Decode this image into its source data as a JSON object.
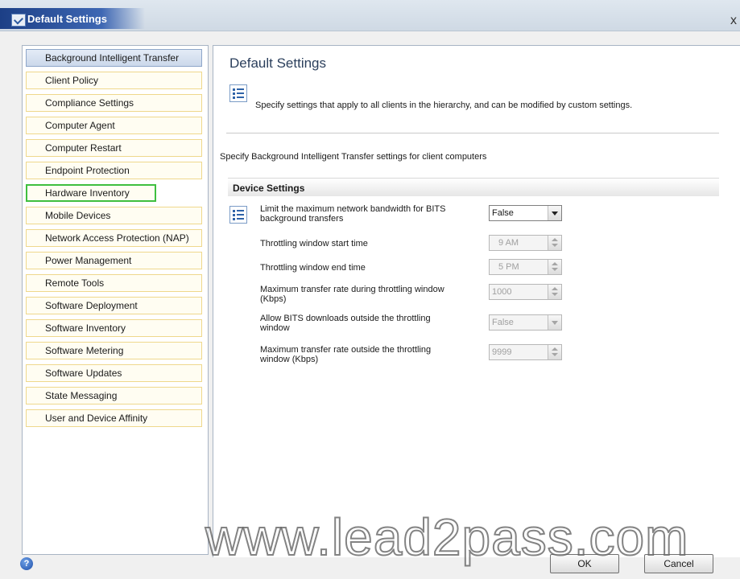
{
  "window": {
    "title": "Default Settings",
    "close_glyph": "x"
  },
  "nav": {
    "items": [
      {
        "label": "Background Intelligent Transfer"
      },
      {
        "label": "Client Policy"
      },
      {
        "label": "Compliance Settings"
      },
      {
        "label": "Computer Agent"
      },
      {
        "label": "Computer Restart"
      },
      {
        "label": "Endpoint Protection"
      },
      {
        "label": "Hardware Inventory"
      },
      {
        "label": "Mobile Devices"
      },
      {
        "label": "Network Access Protection (NAP)"
      },
      {
        "label": "Power Management"
      },
      {
        "label": "Remote Tools"
      },
      {
        "label": "Software Deployment"
      },
      {
        "label": "Software Inventory"
      },
      {
        "label": "Software Metering"
      },
      {
        "label": "Software Updates"
      },
      {
        "label": "State Messaging"
      },
      {
        "label": "User and Device Affinity"
      }
    ],
    "selected": "Background Intelligent Transfer",
    "highlighted": "Hardware Inventory"
  },
  "main": {
    "title": "Default Settings",
    "description": "Specify settings that apply to all clients in the hierarchy, and can be modified by custom settings.",
    "subdescription": "Specify Background Intelligent Transfer settings for client computers",
    "group_title": "Device Settings",
    "settings": {
      "limit_bandwidth": {
        "label": "Limit the maximum network bandwidth for BITS background transfers",
        "value": "False"
      },
      "window_start": {
        "label": "Throttling window start time",
        "value": "9 AM"
      },
      "window_end": {
        "label": "Throttling window end time",
        "value": "5 PM"
      },
      "rate_during": {
        "label": "Maximum transfer rate during throttling window (Kbps)",
        "value": "1000"
      },
      "allow_outside": {
        "label": "Allow BITS downloads outside the throttling window",
        "value": "False"
      },
      "rate_outside": {
        "label": "Maximum transfer rate outside the throttling window (Kbps)",
        "value": "9999"
      }
    }
  },
  "footer": {
    "help_glyph": "?",
    "ok_label": "OK",
    "cancel_label": "Cancel"
  },
  "watermark": "www.lead2pass.com",
  "colors": {
    "title_bar": "#1c3f86",
    "nav_item_border": "#efd88c",
    "highlight": "#3fbf3f"
  }
}
